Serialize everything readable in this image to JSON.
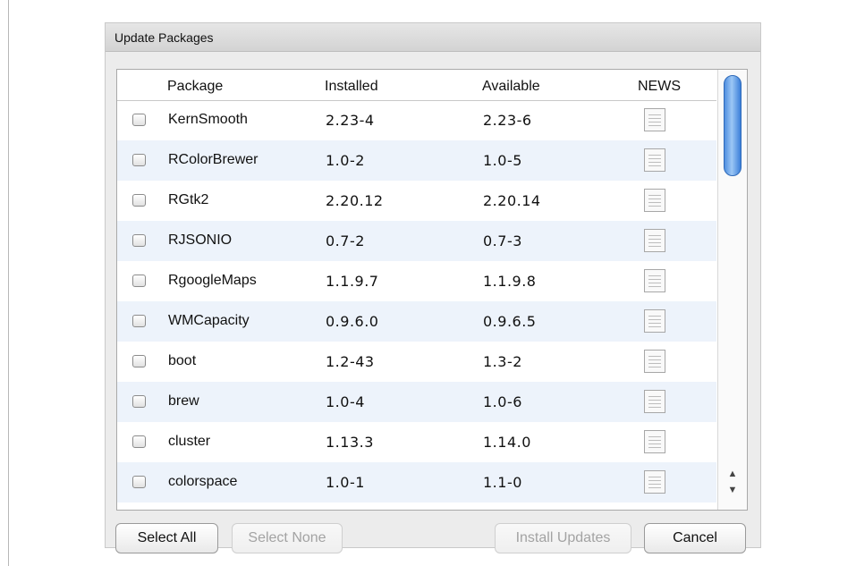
{
  "dialog": {
    "title": "Update Packages"
  },
  "table": {
    "columns": {
      "package": "Package",
      "installed": "Installed",
      "available": "Available",
      "news": "NEWS"
    },
    "rows": [
      {
        "package": "KernSmooth",
        "installed": "2.23-4",
        "available": "2.23-6",
        "checked": false
      },
      {
        "package": "RColorBrewer",
        "installed": "1.0-2",
        "available": "1.0-5",
        "checked": false
      },
      {
        "package": "RGtk2",
        "installed": "2.20.12",
        "available": "2.20.14",
        "checked": false
      },
      {
        "package": "RJSONIO",
        "installed": "0.7-2",
        "available": "0.7-3",
        "checked": false
      },
      {
        "package": "RgoogleMaps",
        "installed": "1.1.9.7",
        "available": "1.1.9.8",
        "checked": false
      },
      {
        "package": "WMCapacity",
        "installed": "0.9.6.0",
        "available": "0.9.6.5",
        "checked": false
      },
      {
        "package": "boot",
        "installed": "1.2-43",
        "available": "1.3-2",
        "checked": false
      },
      {
        "package": "brew",
        "installed": "1.0-4",
        "available": "1.0-6",
        "checked": false
      },
      {
        "package": "cluster",
        "installed": "1.13.3",
        "available": "1.14.0",
        "checked": false
      },
      {
        "package": "colorspace",
        "installed": "1.0-1",
        "available": "1.1-0",
        "checked": false
      }
    ],
    "news_icon": "document-icon"
  },
  "buttons": {
    "select_all": "Select All",
    "select_none": "Select None",
    "install_updates": "Install Updates",
    "cancel": "Cancel"
  },
  "colors": {
    "scroll_thumb": "#4f8fe0",
    "row_alt": "#edf3fb"
  }
}
